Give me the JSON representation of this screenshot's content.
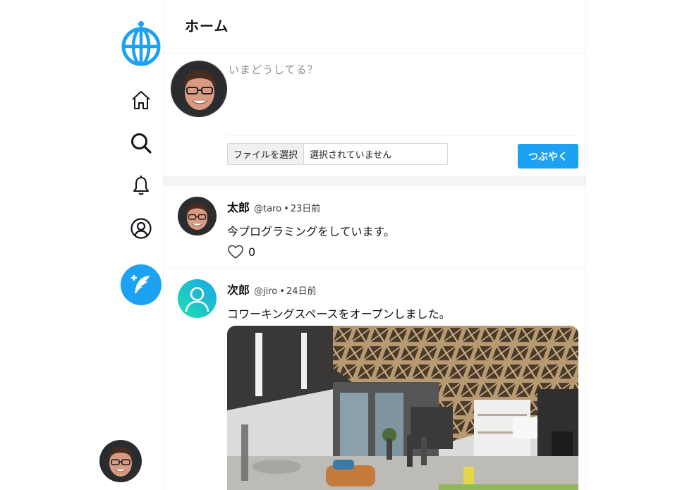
{
  "nav": {
    "items": [
      {
        "icon": "home-icon"
      },
      {
        "icon": "search-icon"
      },
      {
        "icon": "bell-icon"
      },
      {
        "icon": "profile-icon"
      }
    ],
    "tweet_button_icon": "feather-plus-icon",
    "colors": {
      "accent": "#1da1f2"
    }
  },
  "header": {
    "title": "ホーム"
  },
  "composer": {
    "placeholder": "いまどうしてる？",
    "file_button_label": "ファイルを選択",
    "file_status": "選択されていません",
    "submit_label": "つぶやく"
  },
  "posts": [
    {
      "name": "太郎",
      "handle": "@taro",
      "separator": "•",
      "time": "23日前",
      "text": "今プログラミングをしています。",
      "likes": "0"
    },
    {
      "name": "次郎",
      "handle": "@jiro",
      "separator": "•",
      "time": "24日前",
      "text": "コワーキングスペースをオープンしました。"
    }
  ]
}
